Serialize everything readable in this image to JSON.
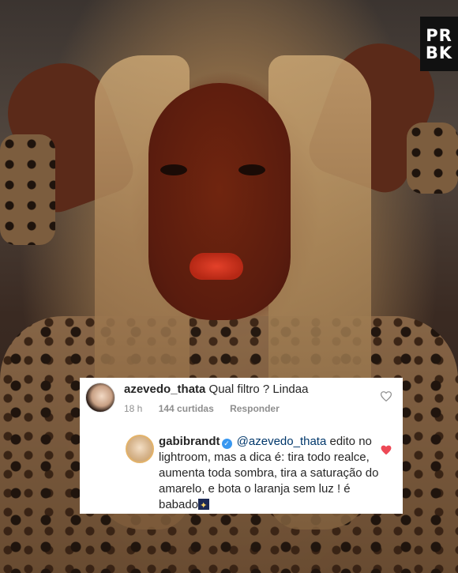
{
  "watermark": {
    "line1": "PR",
    "line2": "BK"
  },
  "comment1": {
    "username": "azevedo_thata",
    "text": "Qual filtro ? Lindaa",
    "time": "18 h",
    "likes": "144 curtidas",
    "reply": "Responder",
    "liked": false
  },
  "comment2": {
    "username": "gabibrandt",
    "mention": "@azevedo_thata",
    "text": "edito no lightroom, mas a dica é: tira todo realce, aumenta toda sombra, tira a saturação do amarelo, e bota o laranja sem luz ! é babado",
    "liked": true
  },
  "colors": {
    "heart_liked": "#ed4956",
    "heart_outline": "#8e8e8e",
    "verified": "#3897f0"
  }
}
